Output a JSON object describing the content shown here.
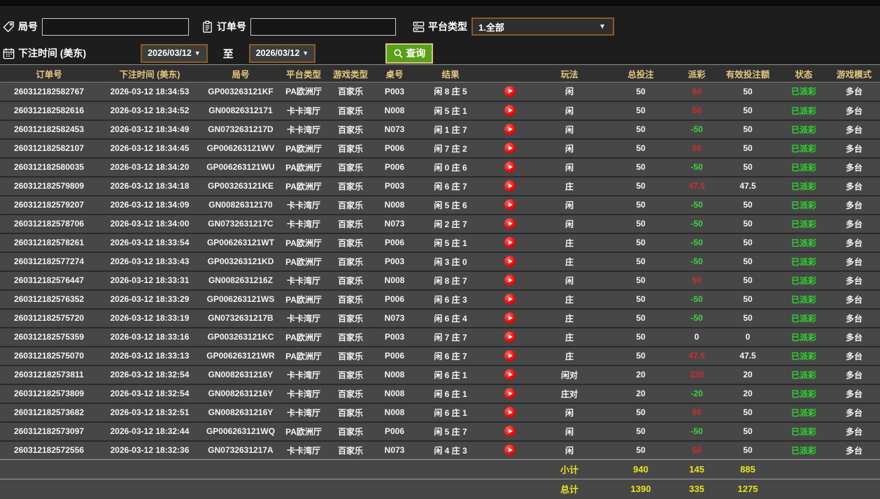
{
  "colors": {
    "header-gold": "#e7c77f",
    "win-red": "#d32c2c",
    "loss-green": "#3bd83b",
    "status-green": "#2fd32f",
    "summary-yellow": "#e8e51c",
    "btn-green": "#58a018",
    "picker-border-brown": "#8a5a26"
  },
  "filters": {
    "round_label": "局号",
    "round_value": "",
    "order_label": "订单号",
    "order_value": "",
    "platform_label": "平台类型",
    "platform_value": "1.全部",
    "time_label": "下注时间 (美东)",
    "date_from": "2026/03/12",
    "to_label": "至",
    "date_to": "2026/03/12",
    "query_label": "查询",
    "caret": "▼"
  },
  "table": {
    "headers": [
      "订单号",
      "下注时间 (美东)",
      "局号",
      "平台类型",
      "游戏类型",
      "桌号",
      "结果",
      "",
      "玩法",
      "总投注",
      "派彩",
      "有效投注额",
      "状态",
      "游戏模式"
    ],
    "rows": [
      {
        "order": "260312182582767",
        "time": "2026-03-12 18:34:53",
        "round": "GP003263121KF",
        "platform": "PA欧洲厅",
        "game": "百家乐",
        "table_no": "P003",
        "result": "闲 8 庄 5",
        "play": "闲",
        "bet": "50",
        "payout": "50",
        "payout_class": "win",
        "valid": "50",
        "status": "已派彩",
        "mode": "多台"
      },
      {
        "order": "260312182582616",
        "time": "2026-03-12 18:34:52",
        "round": "GN00826312171",
        "platform": "卡卡湾厅",
        "game": "百家乐",
        "table_no": "N008",
        "result": "闲 5 庄 1",
        "play": "闲",
        "bet": "50",
        "payout": "50",
        "payout_class": "win",
        "valid": "50",
        "status": "已派彩",
        "mode": "多台"
      },
      {
        "order": "260312182582453",
        "time": "2026-03-12 18:34:49",
        "round": "GN0732631217D",
        "platform": "卡卡湾厅",
        "game": "百家乐",
        "table_no": "N073",
        "result": "闲 1 庄 7",
        "play": "闲",
        "bet": "50",
        "payout": "-50",
        "payout_class": "loss",
        "valid": "50",
        "status": "已派彩",
        "mode": "多台"
      },
      {
        "order": "260312182582107",
        "time": "2026-03-12 18:34:45",
        "round": "GP006263121WV",
        "platform": "PA欧洲厅",
        "game": "百家乐",
        "table_no": "P006",
        "result": "闲 7 庄 2",
        "play": "闲",
        "bet": "50",
        "payout": "50",
        "payout_class": "win",
        "valid": "50",
        "status": "已派彩",
        "mode": "多台"
      },
      {
        "order": "260312182580035",
        "time": "2026-03-12 18:34:20",
        "round": "GP006263121WU",
        "platform": "PA欧洲厅",
        "game": "百家乐",
        "table_no": "P006",
        "result": "闲 0 庄 6",
        "play": "闲",
        "bet": "50",
        "payout": "-50",
        "payout_class": "loss",
        "valid": "50",
        "status": "已派彩",
        "mode": "多台"
      },
      {
        "order": "260312182579809",
        "time": "2026-03-12 18:34:18",
        "round": "GP003263121KE",
        "platform": "PA欧洲厅",
        "game": "百家乐",
        "table_no": "P003",
        "result": "闲 6 庄 7",
        "play": "庄",
        "bet": "50",
        "payout": "47.5",
        "payout_class": "win",
        "valid": "47.5",
        "status": "已派彩",
        "mode": "多台"
      },
      {
        "order": "260312182579207",
        "time": "2026-03-12 18:34:09",
        "round": "GN00826312170",
        "platform": "卡卡湾厅",
        "game": "百家乐",
        "table_no": "N008",
        "result": "闲 5 庄 6",
        "play": "闲",
        "bet": "50",
        "payout": "-50",
        "payout_class": "loss",
        "valid": "50",
        "status": "已派彩",
        "mode": "多台"
      },
      {
        "order": "260312182578706",
        "time": "2026-03-12 18:34:00",
        "round": "GN0732631217C",
        "platform": "卡卡湾厅",
        "game": "百家乐",
        "table_no": "N073",
        "result": "闲 2 庄 7",
        "play": "闲",
        "bet": "50",
        "payout": "-50",
        "payout_class": "loss",
        "valid": "50",
        "status": "已派彩",
        "mode": "多台"
      },
      {
        "order": "260312182578261",
        "time": "2026-03-12 18:33:54",
        "round": "GP006263121WT",
        "platform": "PA欧洲厅",
        "game": "百家乐",
        "table_no": "P006",
        "result": "闲 5 庄 1",
        "play": "庄",
        "bet": "50",
        "payout": "-50",
        "payout_class": "loss",
        "valid": "50",
        "status": "已派彩",
        "mode": "多台"
      },
      {
        "order": "260312182577274",
        "time": "2026-03-12 18:33:43",
        "round": "GP003263121KD",
        "platform": "PA欧洲厅",
        "game": "百家乐",
        "table_no": "P003",
        "result": "闲 3 庄 0",
        "play": "庄",
        "bet": "50",
        "payout": "-50",
        "payout_class": "loss",
        "valid": "50",
        "status": "已派彩",
        "mode": "多台"
      },
      {
        "order": "260312182576447",
        "time": "2026-03-12 18:33:31",
        "round": "GN0082631216Z",
        "platform": "卡卡湾厅",
        "game": "百家乐",
        "table_no": "N008",
        "result": "闲 8 庄 7",
        "play": "闲",
        "bet": "50",
        "payout": "50",
        "payout_class": "win",
        "valid": "50",
        "status": "已派彩",
        "mode": "多台"
      },
      {
        "order": "260312182576352",
        "time": "2026-03-12 18:33:29",
        "round": "GP006263121WS",
        "platform": "PA欧洲厅",
        "game": "百家乐",
        "table_no": "P006",
        "result": "闲 6 庄 3",
        "play": "庄",
        "bet": "50",
        "payout": "-50",
        "payout_class": "loss",
        "valid": "50",
        "status": "已派彩",
        "mode": "多台"
      },
      {
        "order": "260312182575720",
        "time": "2026-03-12 18:33:19",
        "round": "GN0732631217B",
        "platform": "卡卡湾厅",
        "game": "百家乐",
        "table_no": "N073",
        "result": "闲 6 庄 4",
        "play": "庄",
        "bet": "50",
        "payout": "-50",
        "payout_class": "loss",
        "valid": "50",
        "status": "已派彩",
        "mode": "多台"
      },
      {
        "order": "260312182575359",
        "time": "2026-03-12 18:33:16",
        "round": "GP003263121KC",
        "platform": "PA欧洲厅",
        "game": "百家乐",
        "table_no": "P003",
        "result": "闲 7 庄 7",
        "play": "庄",
        "bet": "50",
        "payout": "0",
        "payout_class": "zero",
        "valid": "0",
        "status": "已派彩",
        "mode": "多台"
      },
      {
        "order": "260312182575070",
        "time": "2026-03-12 18:33:13",
        "round": "GP006263121WR",
        "platform": "PA欧洲厅",
        "game": "百家乐",
        "table_no": "P006",
        "result": "闲 6 庄 7",
        "play": "庄",
        "bet": "50",
        "payout": "47.5",
        "payout_class": "win",
        "valid": "47.5",
        "status": "已派彩",
        "mode": "多台"
      },
      {
        "order": "260312182573811",
        "time": "2026-03-12 18:32:54",
        "round": "GN0082631216Y",
        "platform": "卡卡湾厅",
        "game": "百家乐",
        "table_no": "N008",
        "result": "闲 6 庄 1",
        "play": "闲对",
        "bet": "20",
        "payout": "220",
        "payout_class": "win",
        "valid": "20",
        "status": "已派彩",
        "mode": "多台"
      },
      {
        "order": "260312182573809",
        "time": "2026-03-12 18:32:54",
        "round": "GN0082631216Y",
        "platform": "卡卡湾厅",
        "game": "百家乐",
        "table_no": "N008",
        "result": "闲 6 庄 1",
        "play": "庄对",
        "bet": "20",
        "payout": "-20",
        "payout_class": "loss",
        "valid": "20",
        "status": "已派彩",
        "mode": "多台"
      },
      {
        "order": "260312182573682",
        "time": "2026-03-12 18:32:51",
        "round": "GN0082631216Y",
        "platform": "卡卡湾厅",
        "game": "百家乐",
        "table_no": "N008",
        "result": "闲 6 庄 1",
        "play": "闲",
        "bet": "50",
        "payout": "50",
        "payout_class": "win",
        "valid": "50",
        "status": "已派彩",
        "mode": "多台"
      },
      {
        "order": "260312182573097",
        "time": "2026-03-12 18:32:44",
        "round": "GP006263121WQ",
        "platform": "PA欧洲厅",
        "game": "百家乐",
        "table_no": "P006",
        "result": "闲 5 庄 7",
        "play": "闲",
        "bet": "50",
        "payout": "-50",
        "payout_class": "loss",
        "valid": "50",
        "status": "已派彩",
        "mode": "多台"
      },
      {
        "order": "260312182572556",
        "time": "2026-03-12 18:32:36",
        "round": "GN0732631217A",
        "platform": "卡卡湾厅",
        "game": "百家乐",
        "table_no": "N073",
        "result": "闲 4 庄 3",
        "play": "闲",
        "bet": "50",
        "payout": "50",
        "payout_class": "win",
        "valid": "50",
        "status": "已派彩",
        "mode": "多台"
      }
    ],
    "subtotal": {
      "label": "小计",
      "bet": "940",
      "payout": "145",
      "valid": "885"
    },
    "total": {
      "label": "总计",
      "bet": "1390",
      "payout": "335",
      "valid": "1275"
    }
  }
}
